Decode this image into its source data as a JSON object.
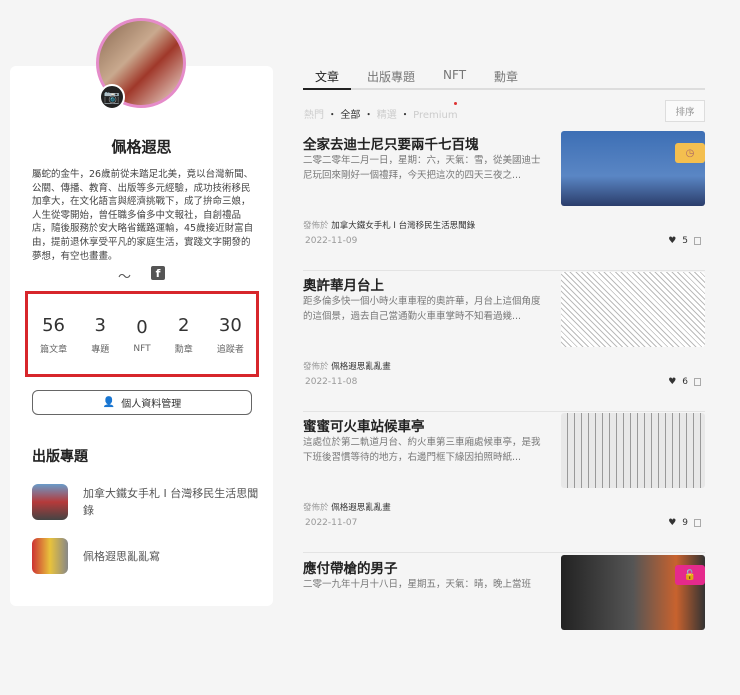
{
  "profile": {
    "name": "佩格遐思",
    "bio": "屬蛇的金牛，26歲前從未踏足北美，竟以台灣新聞、公關、傳播、教育、出版等多元經驗，成功技術移民加拿大，在文化語言與經濟挑戰下，成了拚命三娘，人生從零開始，曾任職多倫多中文報社，自創禮品店，隨後服務於安大略省鐵路運輸，45歲接近財富自由，提前退休享受平凡的家庭生活，實踐文字開發的夢想，有空也畫畫。",
    "stats": [
      {
        "value": "56",
        "label": "篇文章"
      },
      {
        "value": "3",
        "label": "專題"
      },
      {
        "value": "0",
        "label": "NFT"
      },
      {
        "value": "2",
        "label": "勳章"
      },
      {
        "value": "30",
        "label": "追蹤者"
      }
    ],
    "manage_label": "個人資料管理",
    "fb": "f"
  },
  "series": {
    "heading": "出版專題",
    "items": [
      {
        "title": "加拿大鐵女手札 I 台灣移民生活思聞錄"
      },
      {
        "title": "佩格遐思亂亂寫"
      }
    ]
  },
  "tabs": [
    "文章",
    "出版專題",
    "NFT",
    "勳章"
  ],
  "filters": {
    "items": [
      "熱門",
      "全部",
      "精選",
      "Premium"
    ],
    "sep": "・",
    "sort": "排序"
  },
  "articles": [
    {
      "title": "全家去迪士尼只要兩千七百塊",
      "excerpt": "二零二零年二月一日，星期：六，天氣：雪，從美國迪士尼玩回來剛好一個禮拜，今天把這次的四天三夜之...",
      "pub_label": "發佈於",
      "pub": "加拿大鐵女手札 I 台灣移民生活思聞錄",
      "date": "2022-11-09",
      "likes": "5"
    },
    {
      "title": "奧許華月台上",
      "excerpt": "距多倫多快一個小時火車車程的奧許華，月台上這個角度的這個景，過去自己當通勤火車車掌時不知看過幾...",
      "pub_label": "發佈於",
      "pub": "佩格遐思亂亂畫",
      "date": "2022-11-08",
      "likes": "6"
    },
    {
      "title": "蜜蜜可火車站候車亭",
      "excerpt": "這處位於第二軌道月台、約火車第三車廂處候車亭，是我下班後習慣等待的地方，右邊門框下緣因拍照時紙...",
      "pub_label": "發佈於",
      "pub": "佩格遐思亂亂畫",
      "date": "2022-11-07",
      "likes": "9"
    },
    {
      "title": "應付帶槍的男子",
      "excerpt": "二零一九年十月十八日，星期五，天氣：晴，晚上當班"
    }
  ]
}
